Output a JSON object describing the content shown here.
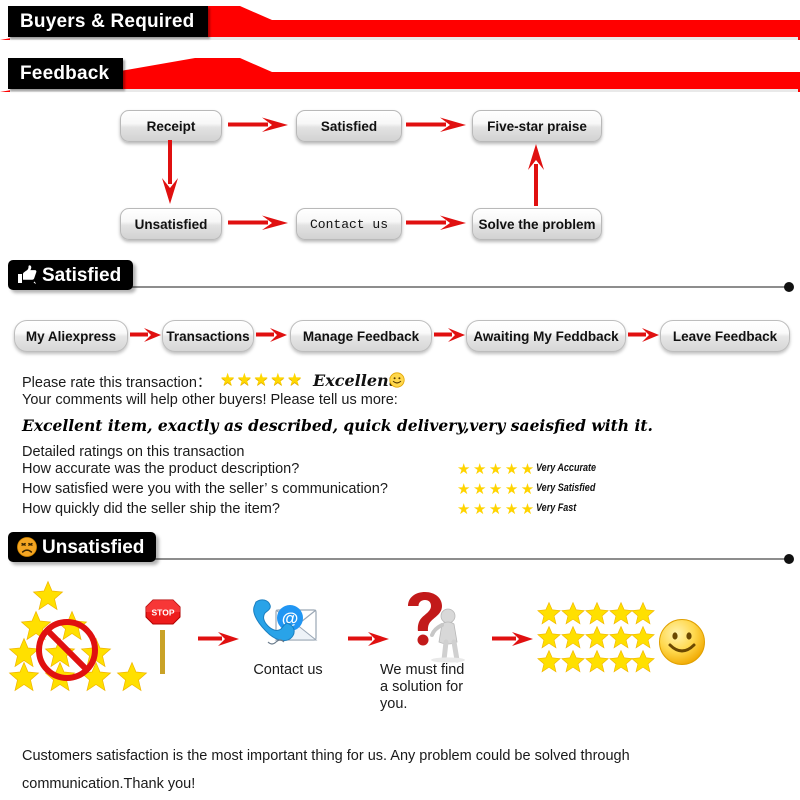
{
  "banners": {
    "buyers": "Buyers & Required",
    "feedback": "Feedback"
  },
  "flow": {
    "boxes": [
      {
        "label": "Receipt"
      },
      {
        "label": "Satisfied"
      },
      {
        "label": "Five-star praise"
      },
      {
        "label": "Unsatisfied"
      },
      {
        "label": "Contact us"
      },
      {
        "label": "Solve the problem"
      }
    ]
  },
  "sections": {
    "satisfied": {
      "label": "Satisfied",
      "icon": "thumbs-up-icon"
    },
    "unsatisfied": {
      "label": "Unsatisfied",
      "icon": "sad-face-icon"
    }
  },
  "breadcrumbs": [
    {
      "label": "My Aliexpress"
    },
    {
      "label": "Transactions"
    },
    {
      "label": "Manage Feedback"
    },
    {
      "label": "Awaiting My Feddback"
    },
    {
      "label": "Leave Feedback"
    }
  ],
  "rating": {
    "prompt": "Please rate this transaction：",
    "stars": "★★★★★",
    "word": "Excellent",
    "emoji": "smiley-face-icon",
    "comments_prompt": "Your comments will help other buyers! Please tell us more:",
    "comment_text": "Excellent item, exactly as described, quick delivery,very saeisfied with it.",
    "detailed_heading": "Detailed ratings on this transaction",
    "rows": [
      {
        "question": "How accurate was the product description?",
        "stars": "★★★★★",
        "value": "Very Accurate"
      },
      {
        "question": "How satisfied were you with the seller’ s communication?",
        "stars": "★★★★★",
        "value": "Very Satisfied"
      },
      {
        "question": "How quickly did the seller ship the item?",
        "stars": "★★★★★",
        "value": "Very Fast"
      }
    ]
  },
  "illustration": {
    "bad_rating": {
      "icon": "stars-prohibited-icon",
      "star_rows": [
        1,
        2,
        3,
        4
      ]
    },
    "stop": {
      "icon": "stop-sign-icon",
      "label": "STOP"
    },
    "contact": {
      "icon": "phone-email-icon",
      "caption": "Contact us"
    },
    "solution": {
      "icon": "question-mark-person-icon",
      "caption": "We must find\na solution for\nyou."
    },
    "good_rating": {
      "icon": "five-star-grid-icon",
      "rows": 3,
      "columns": 5
    },
    "happy": {
      "icon": "smiley-face-icon"
    }
  },
  "footer": {
    "line1": "Customers satisfaction is the most important thing for us. Any problem could be solved through",
    "line2": "communication.Thank you!"
  },
  "colors": {
    "red": "#ff0000",
    "arrow_red": "#e01010",
    "star_yellow": "#ffd400",
    "black": "#000000",
    "rule_grey": "#8d8d8d"
  }
}
